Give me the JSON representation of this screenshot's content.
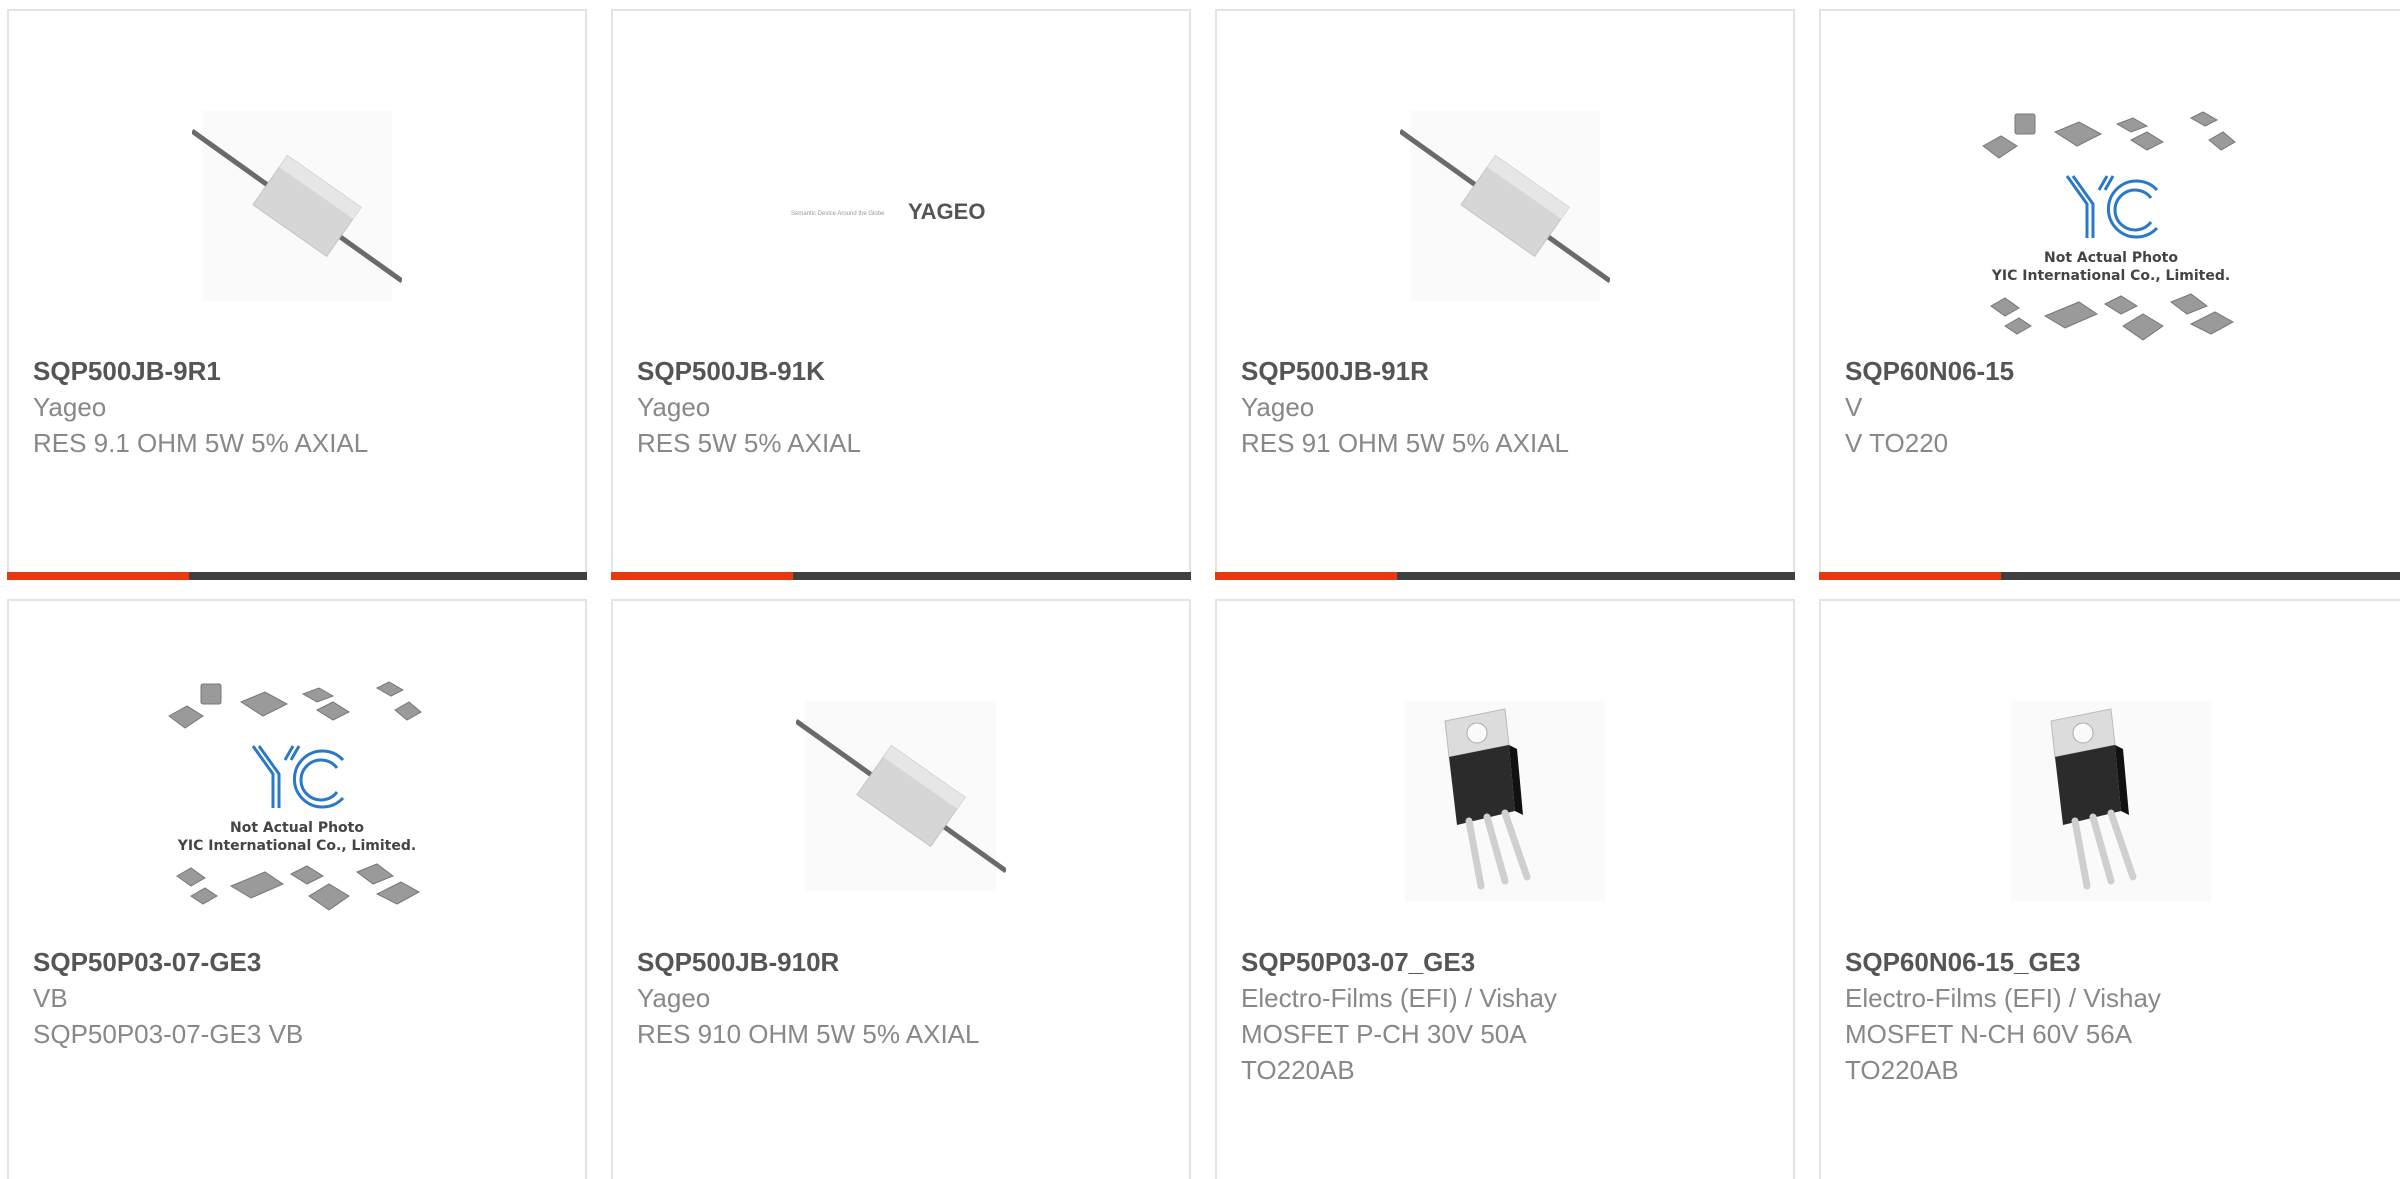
{
  "colors": {
    "accent": "#e8380d",
    "bar_dark": "#404040",
    "text_title": "#555555",
    "text_body": "#888888",
    "border": "#e4e4e4"
  },
  "products": [
    {
      "part": "SQP500JB-9R1",
      "mfr": "Yageo",
      "desc": "RES 9.1 OHM 5W 5% AXIAL",
      "image": "axial-resistor-image"
    },
    {
      "part": "SQP500JB-91K",
      "mfr": "Yageo",
      "desc": "RES 5W 5% AXIAL",
      "image": "yageo-logo-image",
      "logo_text": "YAGEO",
      "logo_tagline": "Semantic Device Around the Globe"
    },
    {
      "part": "SQP500JB-91R",
      "mfr": "Yageo",
      "desc": "RES 91 OHM 5W 5% AXIAL",
      "image": "axial-resistor-image"
    },
    {
      "part": "SQP60N06-15",
      "mfr": "V",
      "desc": "V TO220",
      "image": "yic-placeholder-image",
      "ph_line1": "Not Actual Photo",
      "ph_line2": "YIC International Co., Limited."
    },
    {
      "part": "SQP50P03-07-GE3",
      "mfr": "VB",
      "desc": "SQP50P03-07-GE3 VB",
      "image": "yic-placeholder-image",
      "ph_line1": "Not Actual Photo",
      "ph_line2": "YIC International Co., Limited."
    },
    {
      "part": "SQP500JB-910R",
      "mfr": "Yageo",
      "desc": "RES 910 OHM 5W 5% AXIAL",
      "image": "axial-resistor-image"
    },
    {
      "part": "SQP50P03-07_GE3",
      "mfr": "Electro-Films (EFI) / Vishay",
      "desc": "MOSFET P-CH 30V 50A",
      "desc2": "TO220AB",
      "image": "to220-transistor-image"
    },
    {
      "part": "SQP60N06-15_GE3",
      "mfr": "Electro-Films (EFI) / Vishay",
      "desc": "MOSFET N-CH 60V 56A",
      "desc2": "TO220AB",
      "image": "to220-transistor-image"
    }
  ]
}
